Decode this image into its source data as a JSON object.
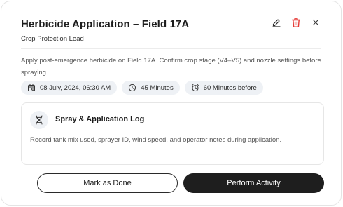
{
  "header": {
    "title": "Herbicide Application – Field 17A",
    "subtitle": "Crop Protection Lead",
    "icons": {
      "edit": "pencil-icon",
      "delete": "trash-icon",
      "close": "close-icon"
    },
    "colors": {
      "delete": "#e53935"
    }
  },
  "description": "Apply post-emergence herbicide on Field 17A. Confirm crop stage (V4–V5) and nozzle settings before spraying.",
  "meta": {
    "date": "08 July, 2024, 06:30 AM",
    "duration": "45 Minutes",
    "reminder": "60 Minutes before"
  },
  "log": {
    "title": "Spray & Application Log",
    "text": "Record tank mix used, sprayer ID, wind speed, and operator notes during application.",
    "icon": "dna-icon"
  },
  "buttons": {
    "mark_done": "Mark as Done",
    "perform": "Perform Activity"
  }
}
